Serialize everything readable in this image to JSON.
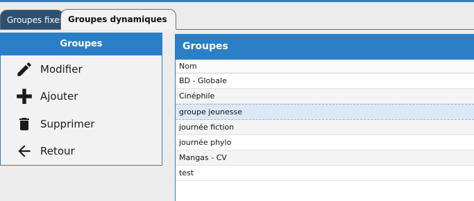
{
  "tabs": [
    {
      "label": "Groupes fixes",
      "active": false
    },
    {
      "label": "Groupes dynamiques",
      "active": true
    }
  ],
  "left_panel": {
    "title": "Groupes",
    "items": [
      {
        "label": "Modifier",
        "icon": "pencil-icon"
      },
      {
        "label": "Ajouter",
        "icon": "plus-icon"
      },
      {
        "label": "Supprimer",
        "icon": "trash-icon"
      },
      {
        "label": "Retour",
        "icon": "arrow-left-icon"
      }
    ]
  },
  "right_panel": {
    "title": "Groupes",
    "column_header": "Nom",
    "rows": [
      "BD - Globale",
      "Cinéphile",
      "groupe jeunesse",
      "journée fiction",
      "journée phylo",
      "Mangas - CV",
      "test"
    ],
    "selected_row": "groupe jeunesse"
  },
  "colors": {
    "accent": "#2a7fc6",
    "tab_inactive": "#2d4f70",
    "selection": "#dde8f6"
  }
}
